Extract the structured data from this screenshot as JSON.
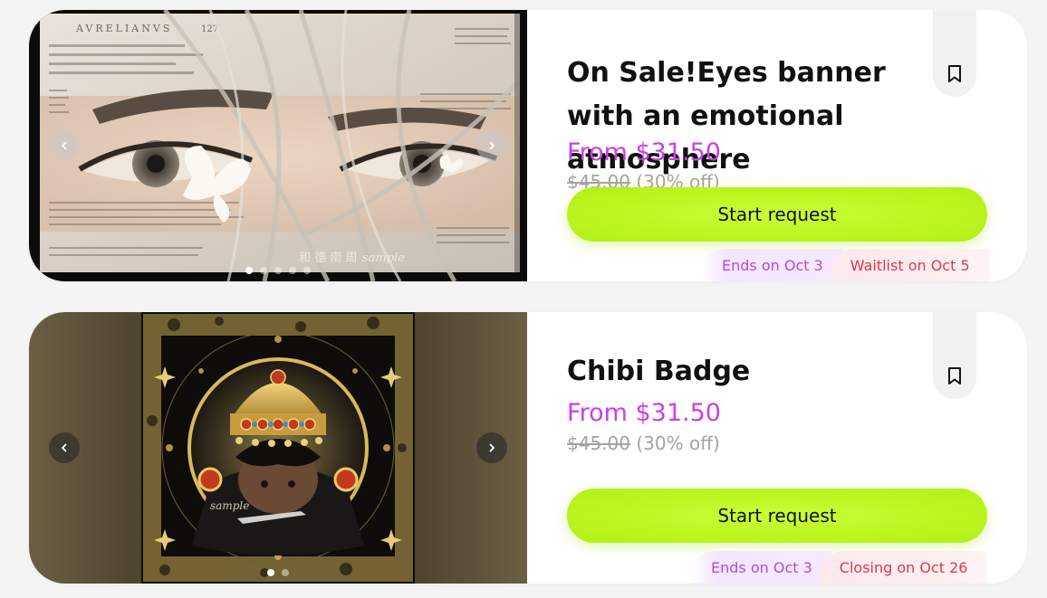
{
  "listings": [
    {
      "title": "On Sale!Eyes banner with an emotional atmosphere",
      "price_text": "From $31.50",
      "original_price": "$45.00",
      "discount": "(30% off)",
      "cta_label": "Start request",
      "badge_ends": "Ends on Oct 3",
      "badge_status": "Waitlist on Oct 5",
      "image_caption": "AVRELIANVS",
      "image_number": "127",
      "image_watermark": "sample",
      "gallery_count": 5,
      "gallery_active": 0,
      "colors": {
        "accent": "#cc3fe6",
        "cta": "#bdf520",
        "status": "#de3a4c"
      }
    },
    {
      "title": "Chibi Badge",
      "price_text": "From $31.50",
      "original_price": "$45.00",
      "discount": "(30% off)",
      "cta_label": "Start request",
      "badge_ends": "Ends on Oct 3",
      "badge_status": "Closing on Oct 26",
      "image_watermark": "sample",
      "gallery_count": 2,
      "gallery_active": 0,
      "colors": {
        "accent": "#cc3fe6",
        "cta": "#bdf520",
        "status": "#de3a4c"
      }
    }
  ],
  "icons": {
    "prev": "chevron-left-icon",
    "next": "chevron-right-icon",
    "save": "bookmark-icon"
  }
}
